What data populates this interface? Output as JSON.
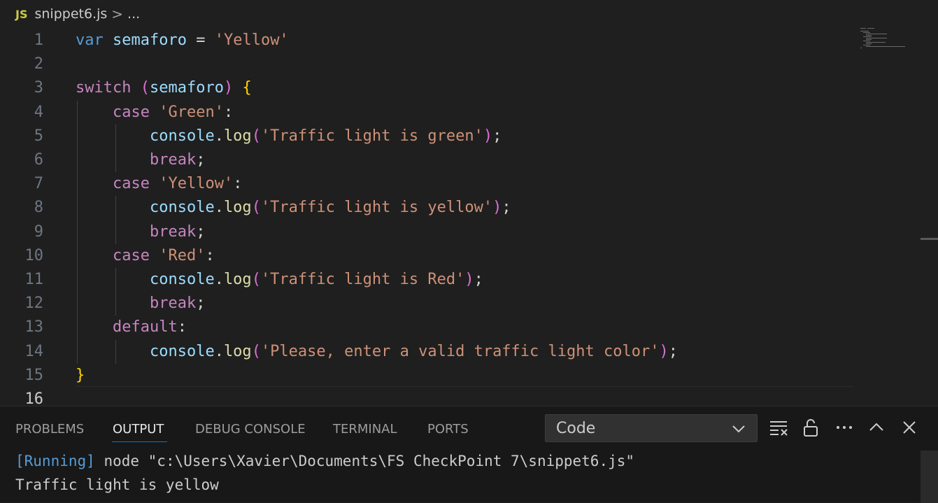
{
  "breadcrumb": {
    "file_badge": "JS",
    "file_name": "snippet6.js",
    "separator": ">",
    "ellipsis": "..."
  },
  "editor": {
    "active_line": 16,
    "lines": [
      {
        "n": "1",
        "tokens": [
          [
            "kw",
            "var"
          ],
          [
            "op",
            " "
          ],
          [
            "var",
            "semaforo"
          ],
          [
            "op",
            " = "
          ],
          [
            "str",
            "'Yellow'"
          ]
        ]
      },
      {
        "n": "2",
        "tokens": []
      },
      {
        "n": "3",
        "tokens": [
          [
            "ctl",
            "switch"
          ],
          [
            "op",
            " "
          ],
          [
            "br2",
            "("
          ],
          [
            "var",
            "semaforo"
          ],
          [
            "br2",
            ")"
          ],
          [
            "op",
            " "
          ],
          [
            "br1",
            "{"
          ]
        ]
      },
      {
        "n": "4",
        "tokens": [
          [
            "op",
            "    "
          ],
          [
            "ctl",
            "case"
          ],
          [
            "op",
            " "
          ],
          [
            "str",
            "'Green'"
          ],
          [
            "op",
            ":"
          ]
        ]
      },
      {
        "n": "5",
        "tokens": [
          [
            "op",
            "        "
          ],
          [
            "var",
            "console"
          ],
          [
            "op",
            "."
          ],
          [
            "fn",
            "log"
          ],
          [
            "br2",
            "("
          ],
          [
            "str",
            "'Traffic light is green'"
          ],
          [
            "br2",
            ")"
          ],
          [
            "op",
            ";"
          ]
        ]
      },
      {
        "n": "6",
        "tokens": [
          [
            "op",
            "        "
          ],
          [
            "ctl",
            "break"
          ],
          [
            "op",
            ";"
          ]
        ]
      },
      {
        "n": "7",
        "tokens": [
          [
            "op",
            "    "
          ],
          [
            "ctl",
            "case"
          ],
          [
            "op",
            " "
          ],
          [
            "str",
            "'Yellow'"
          ],
          [
            "op",
            ":"
          ]
        ]
      },
      {
        "n": "8",
        "tokens": [
          [
            "op",
            "        "
          ],
          [
            "var",
            "console"
          ],
          [
            "op",
            "."
          ],
          [
            "fn",
            "log"
          ],
          [
            "br2",
            "("
          ],
          [
            "str",
            "'Traffic light is yellow'"
          ],
          [
            "br2",
            ")"
          ],
          [
            "op",
            ";"
          ]
        ]
      },
      {
        "n": "9",
        "tokens": [
          [
            "op",
            "        "
          ],
          [
            "ctl",
            "break"
          ],
          [
            "op",
            ";"
          ]
        ]
      },
      {
        "n": "10",
        "tokens": [
          [
            "op",
            "    "
          ],
          [
            "ctl",
            "case"
          ],
          [
            "op",
            " "
          ],
          [
            "str",
            "'Red'"
          ],
          [
            "op",
            ":"
          ]
        ]
      },
      {
        "n": "11",
        "tokens": [
          [
            "op",
            "        "
          ],
          [
            "var",
            "console"
          ],
          [
            "op",
            "."
          ],
          [
            "fn",
            "log"
          ],
          [
            "br2",
            "("
          ],
          [
            "str",
            "'Traffic light is Red'"
          ],
          [
            "br2",
            ")"
          ],
          [
            "op",
            ";"
          ]
        ]
      },
      {
        "n": "12",
        "tokens": [
          [
            "op",
            "        "
          ],
          [
            "ctl",
            "break"
          ],
          [
            "op",
            ";"
          ]
        ]
      },
      {
        "n": "13",
        "tokens": [
          [
            "op",
            "    "
          ],
          [
            "ctl",
            "default"
          ],
          [
            "op",
            ":"
          ]
        ]
      },
      {
        "n": "14",
        "tokens": [
          [
            "op",
            "        "
          ],
          [
            "var",
            "console"
          ],
          [
            "op",
            "."
          ],
          [
            "fn",
            "log"
          ],
          [
            "br2",
            "("
          ],
          [
            "str",
            "'Please, enter a valid traffic light color'"
          ],
          [
            "br2",
            ")"
          ],
          [
            "op",
            ";"
          ]
        ]
      },
      {
        "n": "15",
        "tokens": [
          [
            "br1",
            "}"
          ]
        ]
      },
      {
        "n": "16",
        "tokens": []
      }
    ]
  },
  "panel": {
    "tabs": [
      {
        "label": "PROBLEMS",
        "active": false
      },
      {
        "label": "OUTPUT",
        "active": true
      },
      {
        "label": "DEBUG CONSOLE",
        "active": false
      },
      {
        "label": "TERMINAL",
        "active": false
      },
      {
        "label": "PORTS",
        "active": false
      }
    ],
    "output_channel": "Code",
    "output_lines": {
      "running_tag": "[Running]",
      "command": " node \"c:\\Users\\Xavier\\Documents\\FS CheckPoint 7\\snippet6.js\"",
      "result": "Traffic light is yellow"
    }
  },
  "colors": {
    "background": "#1f1f1f",
    "keyword": "#569cd6",
    "control": "#c586c0",
    "variable": "#9cdcfe",
    "function": "#dcdcaa",
    "string": "#ce9178",
    "accent": "#0078d4"
  },
  "icons": [
    "js-file-icon",
    "chevron-down-icon",
    "clear-output-icon",
    "lock-icon",
    "more-icon",
    "maximize-panel-icon",
    "close-panel-icon"
  ]
}
